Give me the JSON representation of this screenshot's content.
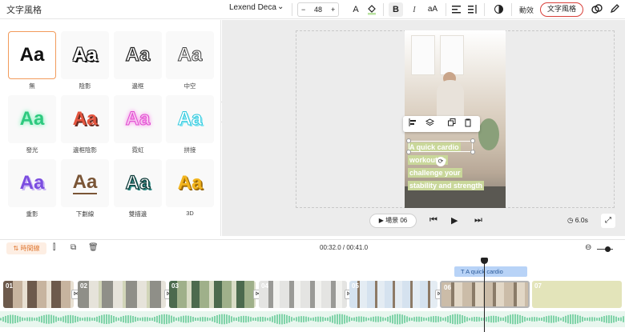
{
  "toolbar": {
    "panel_title": "文字風格",
    "font_name": "Lexend Deca",
    "font_size": "48",
    "minus": "−",
    "plus": "+",
    "text_color_glyph": "A",
    "bold": "B",
    "italic": "I",
    "case": "aA",
    "animation_label": "動效",
    "text_style_label": "文字風格"
  },
  "styles": [
    {
      "label": "無",
      "sample": "Aa"
    },
    {
      "label": "陰影",
      "sample": "Aa"
    },
    {
      "label": "邊框",
      "sample": "Aa"
    },
    {
      "label": "中空",
      "sample": "Aa"
    },
    {
      "label": "發光",
      "sample": "Aa"
    },
    {
      "label": "邊框陰影",
      "sample": "Aa"
    },
    {
      "label": "霓虹",
      "sample": "Aa"
    },
    {
      "label": "拼接",
      "sample": "Aa"
    },
    {
      "label": "重影",
      "sample": "Aa"
    },
    {
      "label": "下劃線",
      "sample": "Aa"
    },
    {
      "label": "雙描邊",
      "sample": "Aa"
    },
    {
      "label": "3D",
      "sample": "Aa"
    }
  ],
  "video_text": [
    "A quick cardio",
    "workout to",
    "challenge your",
    "stability and strength"
  ],
  "player": {
    "scene_label": "場景 06",
    "duration": "6.0s"
  },
  "timeline": {
    "label": "時間線",
    "time": "00:32.0 / 00:41.0",
    "text_clip": "A quick cardio",
    "clips": [
      "01",
      "02",
      "03",
      "04",
      "05",
      "06",
      "07"
    ]
  },
  "colors": {
    "accent": "#e07a35",
    "selected_border": "#d8403a",
    "text_clip": "#b8d3f7",
    "audio_wave": "#7fd3a8"
  }
}
